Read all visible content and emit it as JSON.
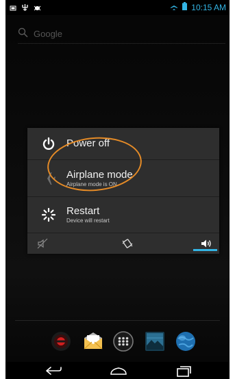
{
  "status_bar": {
    "time": "10:15 AM",
    "icons": [
      "screenshot-icon",
      "usb-debugging-icon",
      "bug-icon",
      "airplane-mode-icon",
      "battery-icon"
    ]
  },
  "search": {
    "placeholder": "Google",
    "icon": "search-icon"
  },
  "dialog": {
    "options": [
      {
        "icon": "power-icon",
        "label": "Power off",
        "sublabel": ""
      },
      {
        "icon": "airplane-icon",
        "label": "Airplane mode",
        "sublabel": "Airplane mode is ON"
      },
      {
        "icon": "restart-icon",
        "label": "Restart",
        "sublabel": "Device will restart"
      }
    ],
    "sound_modes": [
      {
        "icon": "silent-icon",
        "selected": false
      },
      {
        "icon": "vibrate-icon",
        "selected": false
      },
      {
        "icon": "sound-on-icon",
        "selected": true
      }
    ]
  },
  "dock": {
    "apps": [
      "camera-app-icon",
      "email-app-icon",
      "app-drawer-icon",
      "gallery-app-icon",
      "browser-app-icon"
    ]
  },
  "navigation": {
    "buttons": [
      "back-button",
      "home-button",
      "recents-button"
    ]
  },
  "colors": {
    "accent": "#33b5e5",
    "annotation": "#e58b27",
    "dialog_bg": "#2e2e2e"
  }
}
